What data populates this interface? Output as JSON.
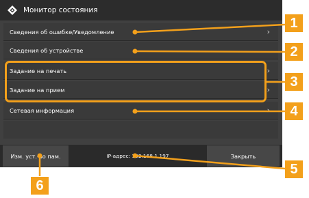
{
  "window": {
    "title": "Монитор состояния",
    "title_icon": "diamond-status-icon"
  },
  "menu": {
    "items": [
      {
        "label": "Сведения об ошибке/Уведомление",
        "has_chevron": true
      },
      {
        "label": "Сведения об устройстве",
        "has_chevron": false
      },
      {
        "label": "Задание на печать",
        "has_chevron": true
      },
      {
        "label": "Задание на прием",
        "has_chevron": true
      },
      {
        "label": "Сетевая информация",
        "has_chevron": true
      }
    ],
    "chevron": "›"
  },
  "bottombar": {
    "left_button": "Изм. уст.-во пам.",
    "ip_text": "IP-адрес: 192.168.1.197",
    "close_button": "Закрыть"
  },
  "callouts": [
    "1",
    "2",
    "3",
    "4",
    "5",
    "6"
  ],
  "colors": {
    "accent": "#f3a01b",
    "panel": "#404040",
    "row": "#3a3a3a",
    "titlebar": "#2c2c2c"
  }
}
